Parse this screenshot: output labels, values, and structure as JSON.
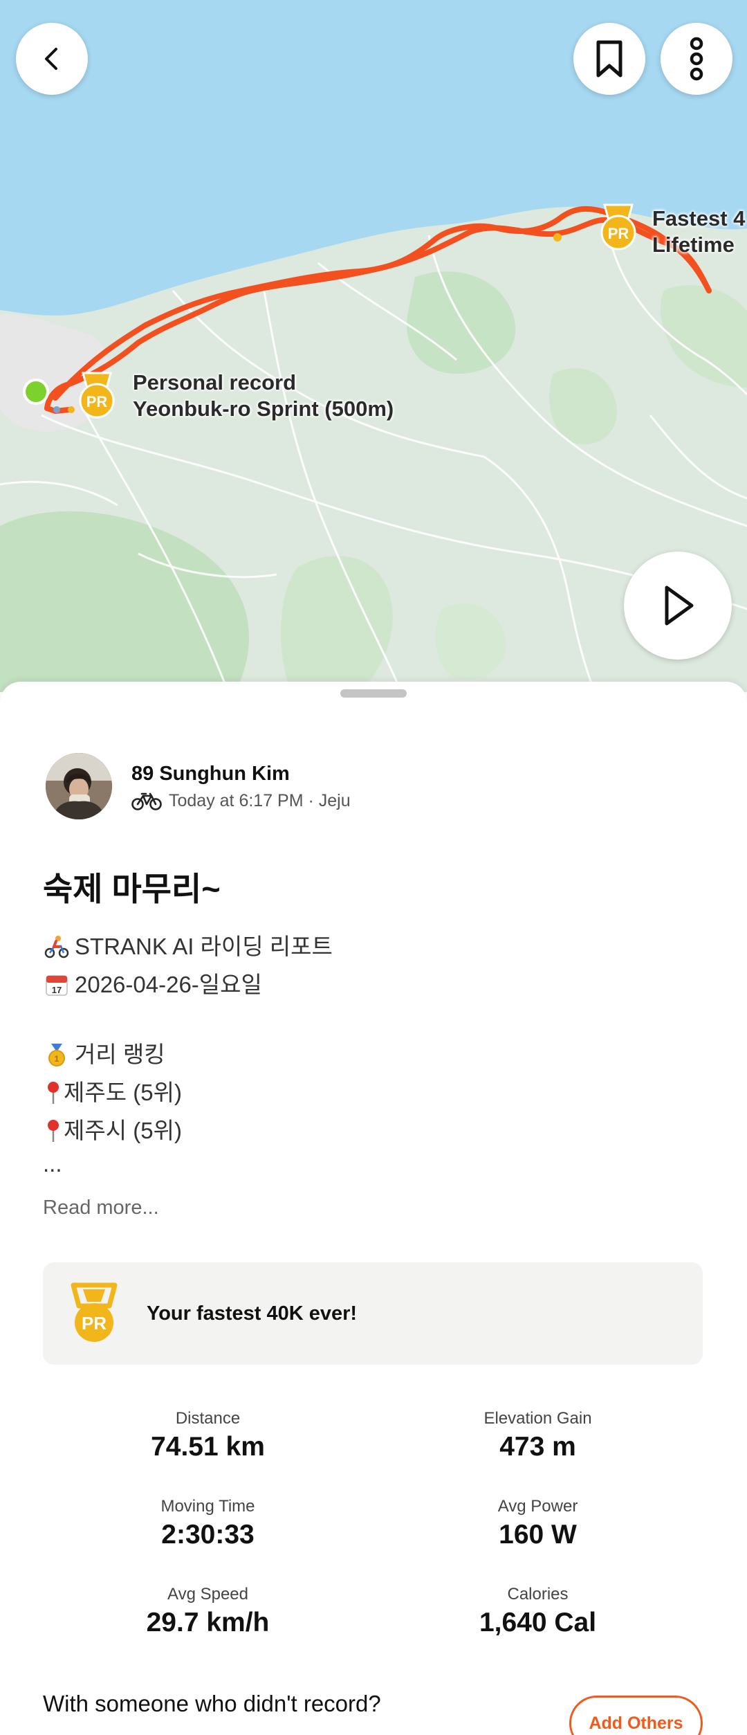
{
  "map": {
    "pr_labels": [
      {
        "line1": "Personal record",
        "line2": "Yeonbuk-ro Sprint (500m)"
      },
      {
        "line1": "Fastest 4",
        "line2": "Lifetime"
      }
    ],
    "pr_badge_text": "PR"
  },
  "colors": {
    "accent": "#f05a1a",
    "route": "#f2501e",
    "sea": "#a6d8f1",
    "land": "#dde8de",
    "start_dot": "#7cd12f",
    "medal": "#f2b51a"
  },
  "icons": [
    "back-icon",
    "bookmark-icon",
    "more-vertical-icon",
    "play-icon",
    "bike-icon",
    "pr-medal-icon"
  ],
  "activity": {
    "athlete_name": "89 Sunghun Kim",
    "meta": "Today at 6:17 PM · Jeju",
    "title": "숙제 마무리~",
    "description": [
      {
        "emoji": "🚴",
        "text": "STRANK AI 라이딩 리포트"
      },
      {
        "emoji": "📅",
        "text": "2026-04-26-일요일"
      },
      {
        "emoji": "🥇",
        "text": "거리 랭킹"
      },
      {
        "emoji": "📍",
        "text": "제주도 (5위)"
      },
      {
        "emoji": "📍",
        "text": "제주시 (5위)"
      },
      {
        "emoji": "",
        "text": "..."
      }
    ],
    "read_more": "Read more...",
    "achievement": "Your fastest 40K ever!"
  },
  "stats": [
    {
      "label": "Distance",
      "value": "74.51 km"
    },
    {
      "label": "Elevation Gain",
      "value": "473 m"
    },
    {
      "label": "Moving Time",
      "value": "2:30:33"
    },
    {
      "label": "Avg Power",
      "value": "160 W"
    },
    {
      "label": "Avg Speed",
      "value": "29.7 km/h"
    },
    {
      "label": "Calories",
      "value": "1,640 Cal"
    }
  ],
  "cta": {
    "text": "With someone who didn't record?",
    "button": "Add Others"
  }
}
